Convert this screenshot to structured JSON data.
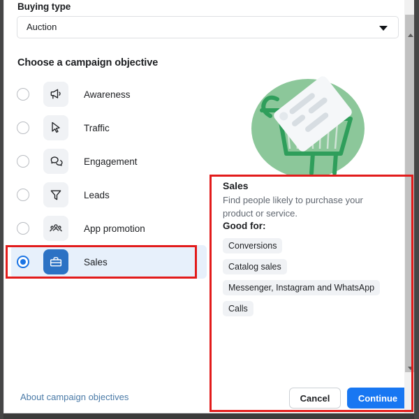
{
  "buying_type": {
    "label": "Buying type",
    "selected": "Auction",
    "caret_icon": "chevron-down-icon"
  },
  "objectives": {
    "heading": "Choose a campaign objective",
    "items": [
      {
        "label": "Awareness",
        "icon": "megaphone-icon",
        "selected": false
      },
      {
        "label": "Traffic",
        "icon": "cursor-arrow-icon",
        "selected": false
      },
      {
        "label": "Engagement",
        "icon": "speech-bubbles-icon",
        "selected": false
      },
      {
        "label": "Leads",
        "icon": "funnel-icon",
        "selected": false
      },
      {
        "label": "App promotion",
        "icon": "people-group-icon",
        "selected": false
      },
      {
        "label": "Sales",
        "icon": "shopping-bag-icon",
        "selected": true
      }
    ]
  },
  "illustration": {
    "name": "shopping-cart-price-tag-illustration",
    "circle_color": "#8cc79a",
    "cart_color": "#2f9e5b",
    "tag_color": "#f5f7f9"
  },
  "info_panel": {
    "title": "Sales",
    "description": "Find people likely to purchase your product or service.",
    "good_for_label": "Good for:",
    "chips": [
      "Conversions",
      "Catalog sales",
      "Messenger, Instagram and WhatsApp",
      "Calls"
    ]
  },
  "footer": {
    "cancel_label": "Cancel",
    "continue_label": "Continue",
    "about_link": "About campaign objectives"
  },
  "annotations": {
    "color": "#e21b1b",
    "sales_row_highlight": true,
    "info_panel_highlight": true
  },
  "colors": {
    "accent_blue": "#1877f2",
    "selected_row_bg": "#e7f0fb",
    "chip_bg": "#f0f2f5",
    "link_blue": "#4a7aa7"
  }
}
